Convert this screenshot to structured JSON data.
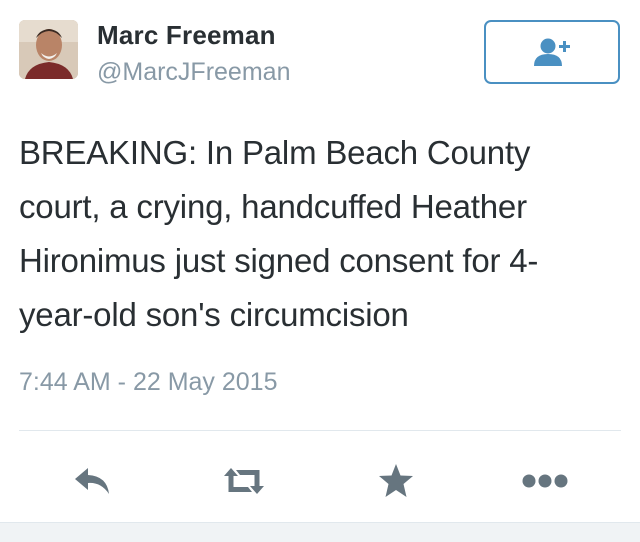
{
  "user": {
    "display_name": "Marc Freeman",
    "handle": "@MarcJFreeman",
    "avatar_icon": "person-photo"
  },
  "follow_button": {
    "icon": "add-user-icon",
    "color": "#4a90c2"
  },
  "tweet": {
    "text": "BREAKING: In Palm Beach County\ncourt, a crying, handcuffed Heather\nHironimus just signed consent for 4-\nyear-old son's circumcision",
    "timestamp": "7:44 AM - 22 May 2015"
  },
  "actions": [
    {
      "icon": "reply-icon"
    },
    {
      "icon": "retweet-icon"
    },
    {
      "icon": "favorite-star-icon"
    },
    {
      "icon": "more-dots-icon"
    }
  ],
  "colors": {
    "text": "#292f33",
    "muted": "#8899a6",
    "action_icon": "#66757f",
    "border": "#e1e8ed"
  }
}
